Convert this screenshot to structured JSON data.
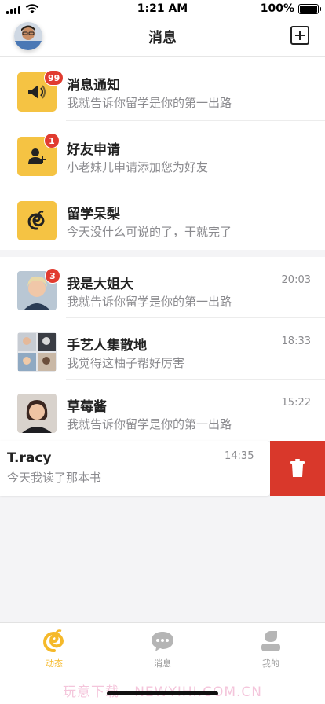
{
  "status_bar": {
    "time": "1:21 AM",
    "battery": "100%"
  },
  "nav": {
    "title": "消息"
  },
  "system_messages": [
    {
      "title": "消息通知",
      "subtitle": "我就告诉你留学是你的第一出路",
      "badge": "99",
      "icon": "megaphone-icon"
    },
    {
      "title": "好友申请",
      "subtitle": "小老妹儿申请添加您为好友",
      "badge": "1",
      "icon": "add-user-icon"
    },
    {
      "title": "留学呆梨",
      "subtitle": "今天没什么可说的了，干就完了",
      "badge": "",
      "icon": "snail-logo-icon"
    }
  ],
  "chats": [
    {
      "title": "我是大姐大",
      "subtitle": "我就告诉你留学是你的第一出路",
      "time": "20:03",
      "badge": "3"
    },
    {
      "title": "手艺人集散地",
      "subtitle": "我觉得这柚子帮好厉害",
      "time": "18:33",
      "badge": ""
    },
    {
      "title": "草莓酱",
      "subtitle": "我就告诉你留学是你的第一出路",
      "time": "15:22",
      "badge": ""
    }
  ],
  "swiped_chat": {
    "title": "T.racy",
    "subtitle": "今天我读了那本书",
    "time": "14:35"
  },
  "tabs": [
    {
      "label": "动态",
      "active": true
    },
    {
      "label": "消息",
      "active": false
    },
    {
      "label": "我的",
      "active": false
    }
  ],
  "watermark": "玩意下载 · NEWYIHI.COM.CN",
  "colors": {
    "accent": "#f5c343",
    "badge": "#e13b2f",
    "delete": "#d9382b"
  }
}
